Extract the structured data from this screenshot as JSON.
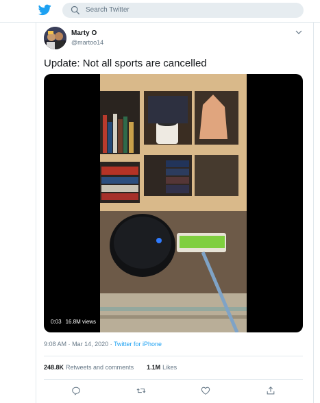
{
  "header": {
    "logo_icon": "twitter-bird-icon",
    "search_icon": "search-icon",
    "search_placeholder": "Search Twitter",
    "brand_color": "#1da1f2"
  },
  "tweet": {
    "author_name": "Marty O",
    "author_handle": "@martoo14",
    "menu_icon": "chevron-down-icon",
    "text": "Update: Not all sports are cancelled",
    "media": {
      "duration": "0:03",
      "views": "16.8M views"
    },
    "time": "9:08 AM",
    "date": "Mar 14, 2020",
    "separator": "·",
    "source": "Twitter for iPhone",
    "stats": {
      "retweets_count": "248.8K",
      "retweets_label": "Retweets and comments",
      "likes_count": "1.1M",
      "likes_label": "Likes"
    },
    "actions": [
      "reply-icon",
      "retweet-icon",
      "like-icon",
      "share-icon"
    ]
  }
}
